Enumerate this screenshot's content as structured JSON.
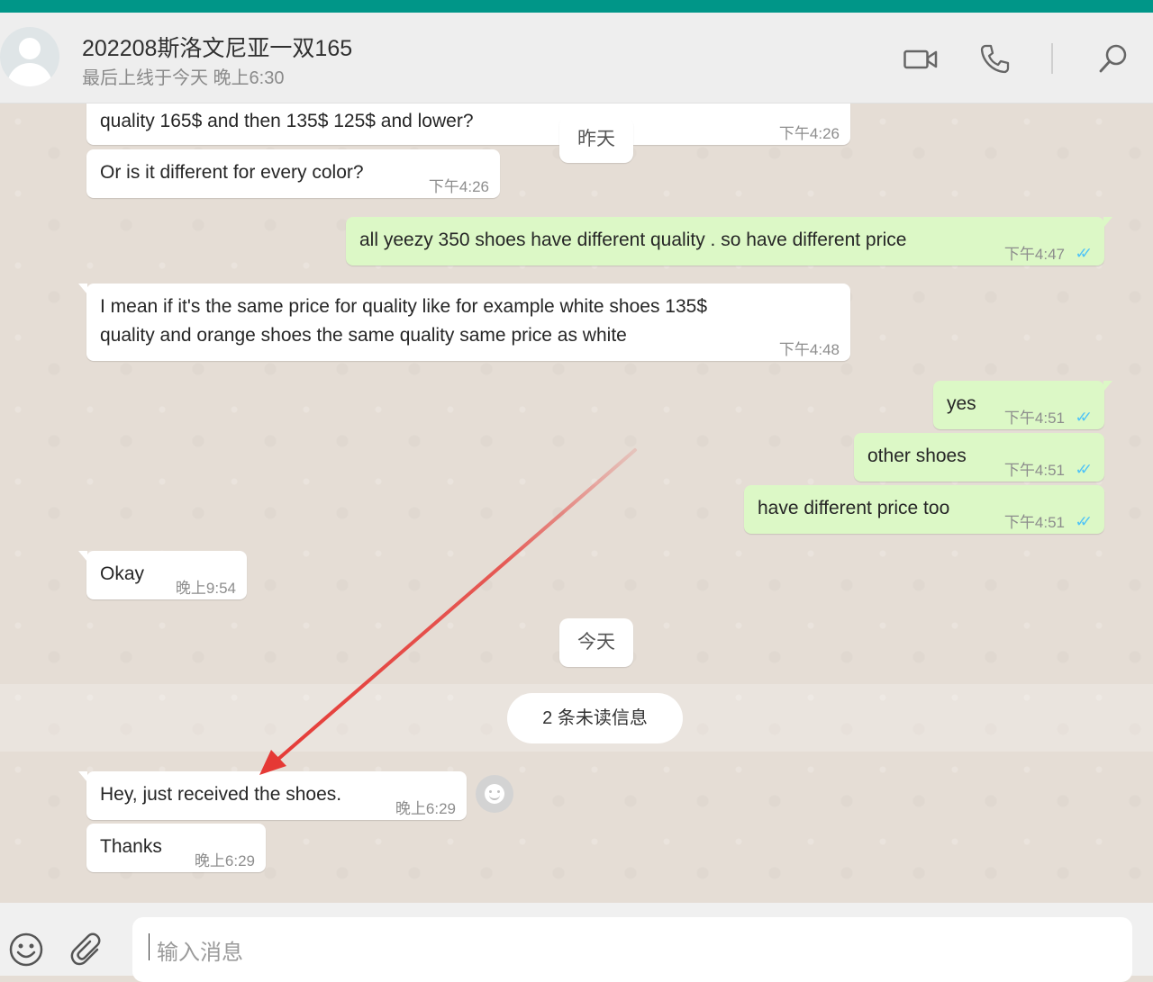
{
  "header": {
    "contact_name": "202208斯洛文尼亚一双165",
    "status": "最后上线于今天 晚上6:30",
    "icons": [
      "video-call-icon",
      "voice-call-icon",
      "search-icon"
    ]
  },
  "date_labels": {
    "yesterday": "昨天",
    "today": "今天"
  },
  "unread_banner": "2 条未读信息",
  "messages": [
    {
      "direction": "in",
      "text": "quality 165$ and then 135$ 125$ and lower?",
      "time": "下午4:26"
    },
    {
      "direction": "in",
      "text": "Or is it different for every color?",
      "time": "下午4:26"
    },
    {
      "direction": "out",
      "text": "all yeezy 350  shoes have different quality . so have different price",
      "time": "下午4:47",
      "status": "read"
    },
    {
      "direction": "in",
      "line1": "I mean if it's the same price for quality like for example white shoes 135$",
      "line2": "quality and orange shoes the same quality same price as white",
      "time": "下午4:48"
    },
    {
      "direction": "out",
      "text": "yes",
      "time": "下午4:51",
      "status": "read"
    },
    {
      "direction": "out",
      "text": "other shoes",
      "time": "下午4:51",
      "status": "read"
    },
    {
      "direction": "out",
      "text": "have different price too",
      "time": "下午4:51",
      "status": "read"
    },
    {
      "direction": "in",
      "text": "Okay",
      "time": "晚上9:54"
    },
    {
      "direction": "in",
      "text": "Hey, just received the shoes.",
      "time": "晚上6:29"
    },
    {
      "direction": "in",
      "text": "Thanks",
      "time": "晚上6:29"
    }
  ],
  "ticks": "✓✓",
  "footer": {
    "placeholder": "输入消息",
    "icons": [
      "emoji-icon",
      "attach-icon"
    ]
  },
  "colors": {
    "topbar": "#009688",
    "outgoing_bubble": "#dcf8c6",
    "incoming_bubble": "#ffffff",
    "chat_background": "#e5ddd5",
    "read_ticks": "#4fc3f7",
    "annotation_arrow": "#e53935"
  }
}
